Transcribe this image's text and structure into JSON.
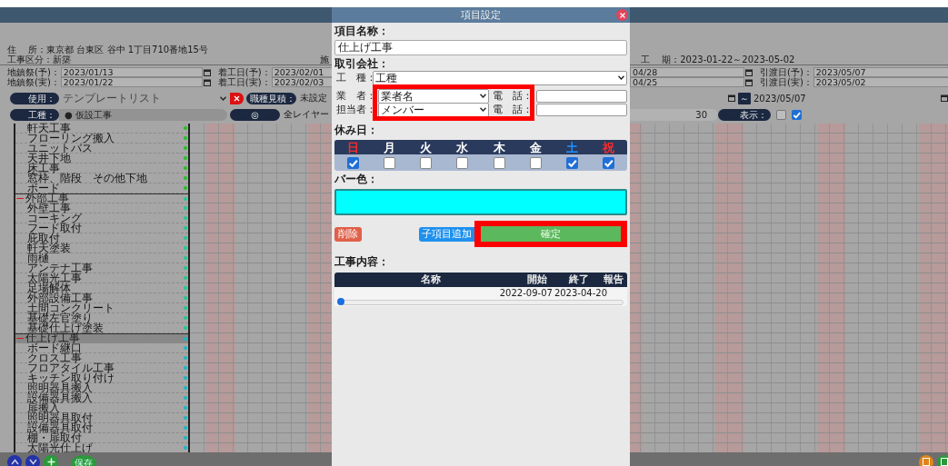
{
  "project": {
    "address": "住　 所：東京都 台東区 谷中 1丁目710番地15号",
    "category": "工事区分：新築",
    "category_next": "施",
    "period": "工　 期：2023-01-22～2023-05-02"
  },
  "date_rows": [
    {
      "left": [
        {
          "label": "地鎮祭(予)：",
          "value": "2023/01/13"
        },
        {
          "label": "着工日(予)：",
          "value": "2023/02/01"
        }
      ],
      "right": [
        {
          "value": "04/28"
        },
        {
          "label": "引渡日(予)：",
          "value": "2023/05/07"
        }
      ]
    },
    {
      "left": [
        {
          "label": "地鎮祭(実)：",
          "value": "2023/01/22"
        },
        {
          "label": "着工日(実)：",
          "value": "2023/02/03"
        }
      ],
      "right": [
        {
          "value": "04/25"
        },
        {
          "label": "引渡日(実)：",
          "value": "2023/05/02"
        }
      ]
    }
  ],
  "toolbar": {
    "template_label": "使用：",
    "template_value": "テンプレートリスト",
    "estimate_label": "職種見積：",
    "estimate_value": "未設定",
    "range_separator": "～",
    "range_end": "2023/05/07",
    "trade_label": "工種：",
    "trade_value": "● 仮設工事",
    "layer_icon": "◎",
    "layer_value": "全レイヤー",
    "scale": "30",
    "display_label": "表示：",
    "display_options": [
      {
        "checked": false
      },
      {
        "checked": true
      }
    ]
  },
  "groups": [
    {
      "selected": false,
      "color": "#22c322",
      "items": [
        "軒天工事",
        "フローリング搬入",
        "ユニットバス",
        "天井下地",
        "床工事",
        "窓枠、階段　その他下地",
        "ボード"
      ]
    },
    {
      "toggle": "−",
      "name": "外部工事",
      "selected": false,
      "color": "#1fcc88",
      "items": [
        "外壁工事",
        "コーキング",
        "フード取付",
        "庇取付",
        "軒天塗装",
        "雨樋",
        "アンテナ工事",
        "太陽光工事",
        "足場解体",
        "外部設備工事",
        "土間コンクリート",
        "基礎左官塗り",
        "基礎仕上げ塗装"
      ]
    },
    {
      "toggle": "−",
      "name": "仕上げ工事",
      "selected": true,
      "color": "#19b8c8",
      "items": [
        "ボード継口",
        "クロス工事",
        "フロアタイル工事",
        "キッチン取り付け",
        "照明器具搬入",
        "設備器具搬入",
        "扉搬入",
        "照明器具取付",
        "設備器具取付",
        "棚・扉取付",
        "太陽光仕上げ"
      ]
    }
  ],
  "bottom_bar": {
    "save": "保存"
  },
  "dialog": {
    "title": "項目設定",
    "name_label": "項目名称：",
    "name_value": "仕上げ工事",
    "company_label": "取引会社：",
    "trade": {
      "label": "工　種：",
      "value": "工種"
    },
    "contacts": [
      {
        "label": "業　者：",
        "value": "業者名",
        "phone_label": "電　話："
      },
      {
        "label": "担当者：",
        "value": "メンバー",
        "phone_label": "電　話："
      }
    ],
    "holiday_label": "休み日：",
    "weekdays": [
      {
        "label": "日",
        "kind": "holiday",
        "checked": true
      },
      {
        "label": "月",
        "kind": "weekday",
        "checked": false
      },
      {
        "label": "火",
        "kind": "weekday",
        "checked": false
      },
      {
        "label": "水",
        "kind": "weekday",
        "checked": false
      },
      {
        "label": "木",
        "kind": "weekday",
        "checked": false
      },
      {
        "label": "金",
        "kind": "weekday",
        "checked": false
      },
      {
        "label": "土",
        "kind": "saturday",
        "checked": true
      },
      {
        "label": "祝",
        "kind": "holiday",
        "checked": true
      }
    ],
    "bar_color_label": "バー色：",
    "bar": {
      "color": "#00ffff"
    },
    "delete": "削除",
    "add_child": "子項目追加",
    "confirm": "確定",
    "content_label": "工事内容：",
    "columns": [
      "名称",
      "開始",
      "終了",
      "報告"
    ],
    "rows": [
      {
        "start": "2022-09-07",
        "end": "2023-04-20"
      }
    ],
    "highlight_contacts": true,
    "highlight_confirm": true
  }
}
